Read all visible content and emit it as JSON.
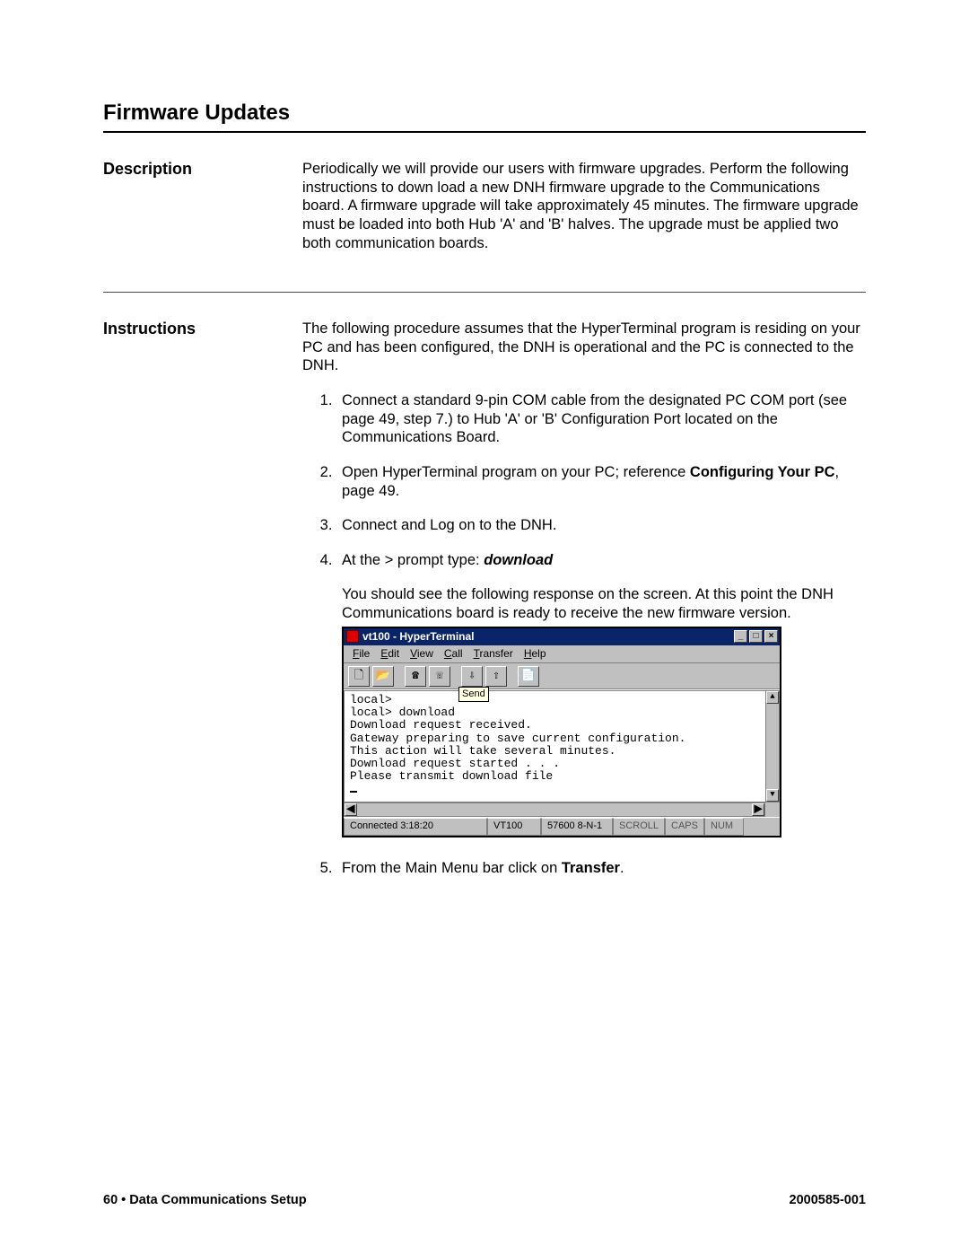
{
  "page": {
    "title": "Firmware Updates",
    "footer_left": "60  •  Data Communications Setup",
    "footer_right": "2000585-001"
  },
  "sections": {
    "description": {
      "heading": "Description",
      "paragraph": "Periodically we will provide our users with firmware upgrades. Perform the following instructions to down load a new DNH firmware upgrade to the Communications board. A firmware upgrade will take approximately 45 minutes. The firmware upgrade must be loaded into both Hub 'A' and 'B' halves. The upgrade must be applied two both communication boards."
    },
    "instructions": {
      "heading": "Instructions",
      "intro": "The following procedure assumes that the HyperTerminal program is residing on your PC and has been configured, the DNH is operational and the PC is connected to the DNH.",
      "steps": [
        {
          "text": "Connect a standard 9-pin COM cable from the designated PC COM port (see page 49, step 7.) to Hub 'A' or 'B' Configuration Port located on the Communications Board."
        },
        {
          "pre": "Open HyperTerminal program on your PC; reference ",
          "bold": "Configuring Your PC",
          "post": ", page 49."
        },
        {
          "text": "Connect and Log on to the DNH."
        },
        {
          "pre": "At the > prompt type: ",
          "bolditalic": "download",
          "after": "You should see the following response on the screen. At this point the DNH Communications board is ready to receive the new firmware version."
        },
        {
          "pre": "From the Main Menu bar click on ",
          "bold": "Transfer",
          "post": "."
        }
      ]
    }
  },
  "terminal": {
    "title": "vt100 - HyperTerminal",
    "menus": [
      "File",
      "Edit",
      "View",
      "Call",
      "Transfer",
      "Help"
    ],
    "toolbar_icons": [
      "new-icon",
      "open-icon",
      "connect-icon",
      "disconnect-icon",
      "send-icon",
      "receive-icon",
      "properties-icon"
    ],
    "tooltip": "Send",
    "body_lines": [
      "local>",
      "local> download",
      "Download request received.",
      "Gateway preparing to save current configuration.",
      "This action will take several minutes.",
      "Download request started . . .",
      "Please transmit download file"
    ],
    "status": {
      "connected": "Connected 3:18:20",
      "emulation": "VT100",
      "settings": "57600 8-N-1",
      "scroll": "SCROLL",
      "caps": "CAPS",
      "num": "NUM"
    }
  }
}
